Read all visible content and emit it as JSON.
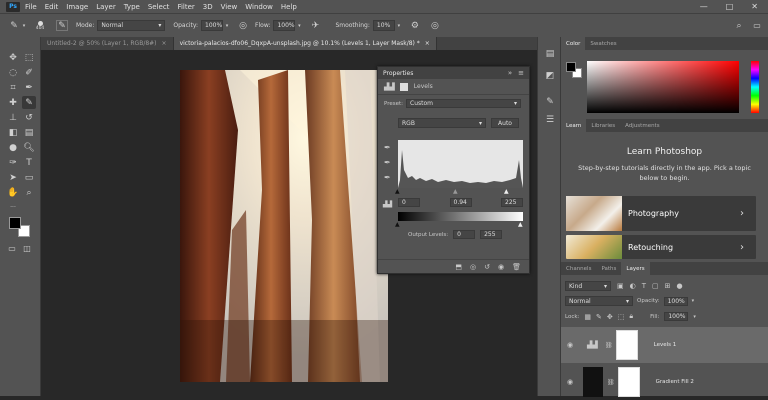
{
  "app": {
    "logo": "Ps"
  },
  "menu": [
    "File",
    "Edit",
    "Image",
    "Layer",
    "Type",
    "Select",
    "Filter",
    "3D",
    "View",
    "Window",
    "Help"
  ],
  "options_bar": {
    "brush_size": "404",
    "mode_label": "Mode:",
    "mode_value": "Normal",
    "opacity_label": "Opacity:",
    "opacity_value": "100%",
    "flow_label": "Flow:",
    "flow_value": "100%",
    "smoothing_label": "Smoothing:",
    "smoothing_value": "10%"
  },
  "tabs": [
    {
      "label": "Untitled-2 @ 50% (Layer 1, RGB/8#)",
      "close": "×"
    },
    {
      "label": "victoria-palacios-dfo06_DqxpA-unsplash.jpg @ 10.1% (Levels 1, Layer Mask/8) *",
      "close": "×"
    }
  ],
  "properties": {
    "tab": "Properties",
    "menu_glyph": "»",
    "levels_label": "Levels",
    "preset_label": "Preset:",
    "preset_value": "Custom",
    "channel_value": "RGB",
    "auto_label": "Auto",
    "input_black": "0",
    "input_gamma": "0.94",
    "input_white": "225",
    "output_label": "Output Levels:",
    "output_black": "0",
    "output_white": "255"
  },
  "color_panel": {
    "tabs": [
      "Color",
      "Swatches"
    ],
    "fg": "#000000",
    "bg": "#ffffff"
  },
  "learn_panel": {
    "tabs": [
      "Learn",
      "Libraries",
      "Adjustments"
    ],
    "title": "Learn Photoshop",
    "desc": "Step-by-step tutorials directly in the app. Pick a topic below to begin.",
    "items": [
      {
        "label": "Photography",
        "chevron": "›"
      },
      {
        "label": "Retouching",
        "chevron": "›"
      }
    ]
  },
  "layers_panel": {
    "tabs": [
      "Channels",
      "Paths",
      "Layers"
    ],
    "kind_label": "Kind",
    "blend_value": "Normal",
    "opacity_label": "Opacity:",
    "opacity_value": "100%",
    "lock_label": "Lock:",
    "fill_label": "Fill:",
    "fill_value": "100%",
    "layers": [
      {
        "name": "Levels 1"
      },
      {
        "name": "Gradient Fill 2"
      }
    ]
  },
  "icons": [
    "search-icon",
    "workspace-icon",
    "share-icon",
    "brush-icon",
    "settings-icon",
    "eye-icon",
    "chain-icon",
    "eyedropper-icon",
    "trash-icon"
  ]
}
